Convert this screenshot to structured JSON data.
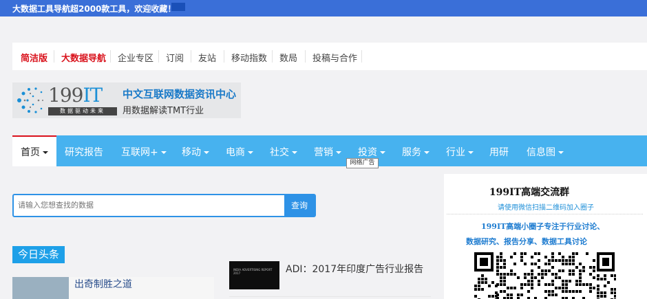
{
  "topbar": {
    "text": "大数据工具导航超2000款工具，欢迎收藏！"
  },
  "subnav": {
    "items": [
      "简洁版",
      "大数据导航",
      "企业专区",
      "订阅",
      "友站",
      "移动指数",
      "数局",
      "投稿与合作"
    ]
  },
  "logo": {
    "number": "199",
    "suffix": "IT",
    "slogan": "数据驱动未来",
    "title": "中文互联网数据资讯中心",
    "subtitle": "用数据解读TMT行业"
  },
  "mainnav": {
    "items": [
      "首页",
      "研究报告",
      "互联网+",
      "移动",
      "电商",
      "社交",
      "营销",
      "投资",
      "服务",
      "行业",
      "用研",
      "信息图"
    ],
    "tooltip": "网络广告"
  },
  "search": {
    "placeholder": "请输入您想查找的数据",
    "button": "查询"
  },
  "headline": {
    "tag": "今日头条",
    "left_caption": "出奇制胜之道"
  },
  "news": {
    "title": "ADI：2017年印度广告行业报告",
    "thumb_text": "INDIA ADVERTISING REPORT 2017"
  },
  "sidebar": {
    "title": "199IT高端交流群",
    "subtitle": "请使用微信扫描二维码加入圈子",
    "line1": "199IT高端小圈子专注于行业讨论、",
    "line2": "数据研究、报告分享、数据工具讨论"
  },
  "colors": {
    "topbar": "#3a6fd8",
    "nav": "#47b2ef",
    "accent_red": "#d9111b",
    "search_blue": "#2e92e6"
  }
}
